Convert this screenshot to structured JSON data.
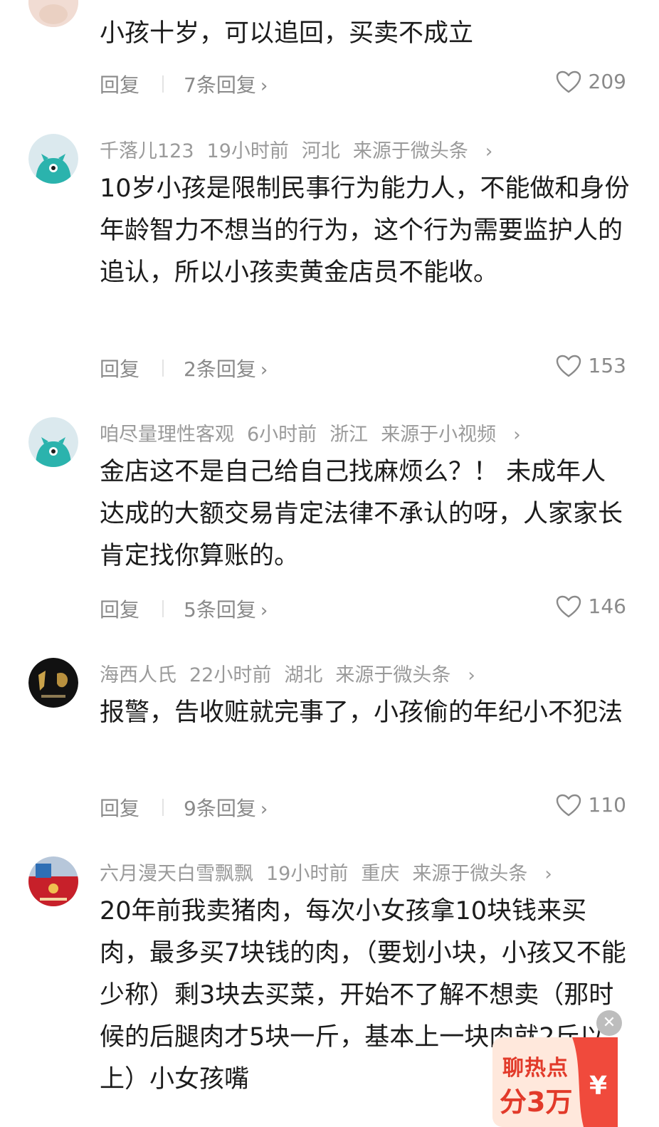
{
  "reply_label": "回复",
  "comments": [
    {
      "body": "小孩十岁，可以追回，买卖不成立",
      "replies": "7条回复",
      "likes": "209"
    },
    {
      "user": "千落儿123",
      "time": "19小时前",
      "region": "河北",
      "source": "来源于微头条",
      "body": "10岁小孩是限制民事行为能力人，不能做和身份年龄智力不想当的行为，这个行为需要监护人的追认，所以小孩卖黄金店员不能收。",
      "replies": "2条回复",
      "likes": "153"
    },
    {
      "user": "咱尽量理性客观",
      "time": "6小时前",
      "region": "浙江",
      "source": "来源于小视频",
      "body": "金店这不是自己给自己找麻烦么？！ 未成年人达成的大额交易肯定法律不承认的呀，人家家长肯定找你算账的。",
      "replies": "5条回复",
      "likes": "146"
    },
    {
      "user": "海西人氏",
      "time": "22小时前",
      "region": "湖北",
      "source": "来源于微头条",
      "body": "报警，告收赃就完事了，小孩偷的年纪小不犯法",
      "replies": "9条回复",
      "likes": "110"
    },
    {
      "user": "六月漫天白雪飘飘",
      "time": "19小时前",
      "region": "重庆",
      "source": "来源于微头条",
      "body": "20年前我卖猪肉，每次小女孩拿10块钱来买肉，最多买7块钱的肉，（要划小块，小孩又不能少称）剩3块去买菜，开始不了解不想卖（那时候的后腿肉才5块一斤，基本上一块肉就2斤以上）小女孩嘴"
    }
  ],
  "promo": {
    "line1": "聊热点",
    "line2": "分3万",
    "currency": "¥",
    "close": "✕"
  },
  "colors": {
    "avatar_teal": "#2bb3ad",
    "promo_red": "#f04a3c",
    "promo_text": "#e23a2a"
  }
}
